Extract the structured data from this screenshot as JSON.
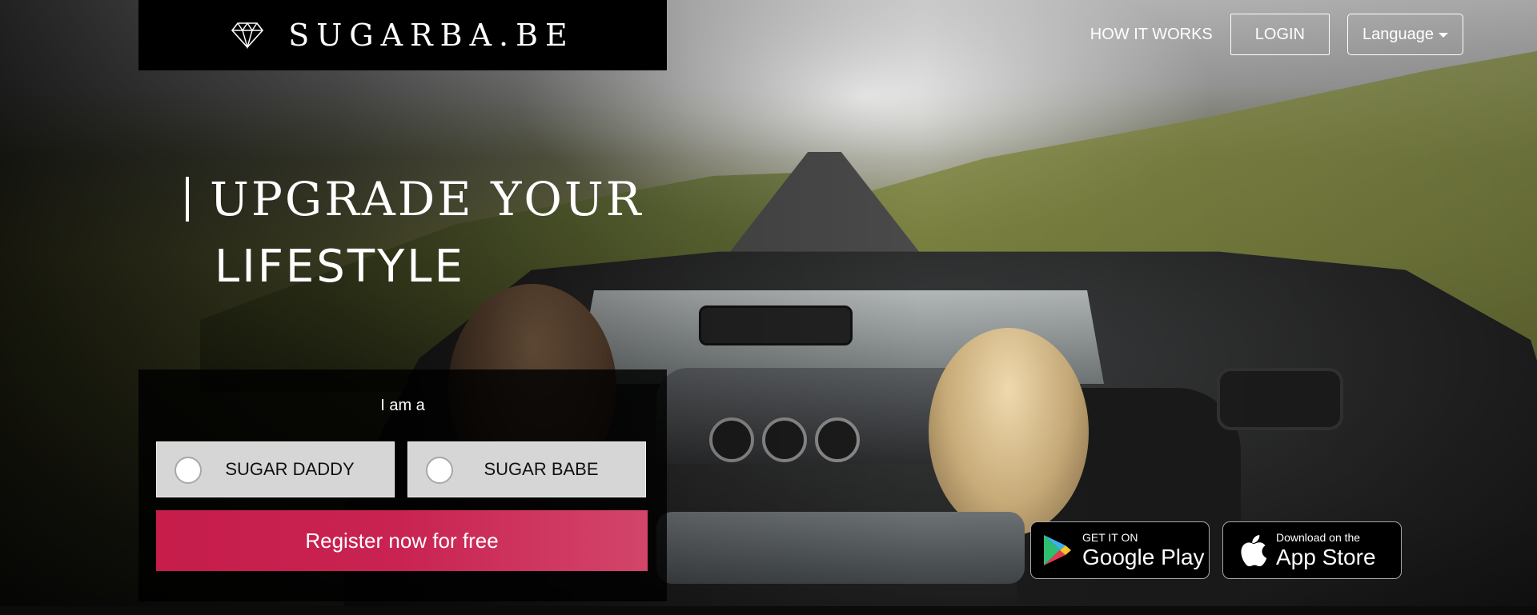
{
  "brand": {
    "name": "SUGARBA.BE",
    "icon": "diamond-icon"
  },
  "nav": {
    "how_it_works": "HOW IT WORKS",
    "login": "LOGIN",
    "language": "Language"
  },
  "hero": {
    "headline_line1": "UPGRADE YOUR",
    "headline_line2": "LIFESTYLE"
  },
  "form": {
    "prompt": "I am a",
    "option_daddy": "SUGAR DADDY",
    "option_babe": "SUGAR BABE",
    "register": "Register now for free"
  },
  "stores": {
    "google_small": "GET IT ON",
    "google_big": "Google Play",
    "apple_small": "Download on the",
    "apple_big": "App Store"
  },
  "colors": {
    "accent": "#c61d4b",
    "logo_bg": "#000000"
  }
}
